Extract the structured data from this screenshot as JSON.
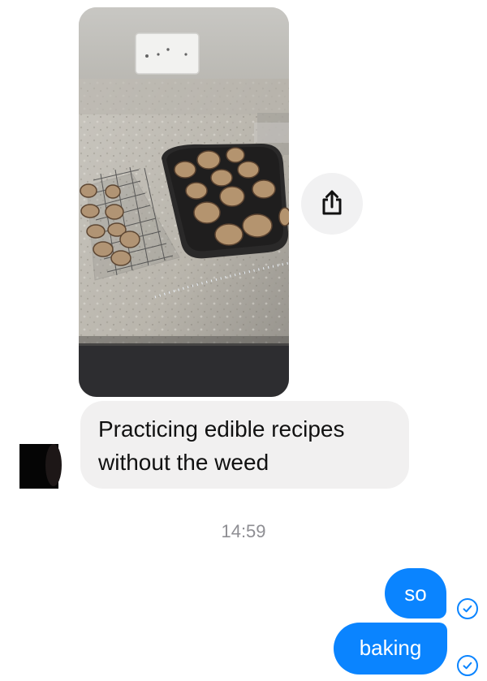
{
  "conversation": {
    "incoming": {
      "image_description": "photo-of-cookies-on-baking-tray-and-cooling-rack",
      "share_icon": "share-icon",
      "message_text": "Practicing edible recipes without the weed"
    },
    "timestamp": "14:59",
    "outgoing": [
      {
        "text": "so",
        "status_icon": "read-check-icon"
      },
      {
        "text": "baking",
        "status_icon": "read-check-icon"
      }
    ]
  },
  "colors": {
    "outgoing_bubble": "#0a84ff",
    "incoming_bubble": "#f1f0f0",
    "timestamp": "#8e8e93"
  }
}
